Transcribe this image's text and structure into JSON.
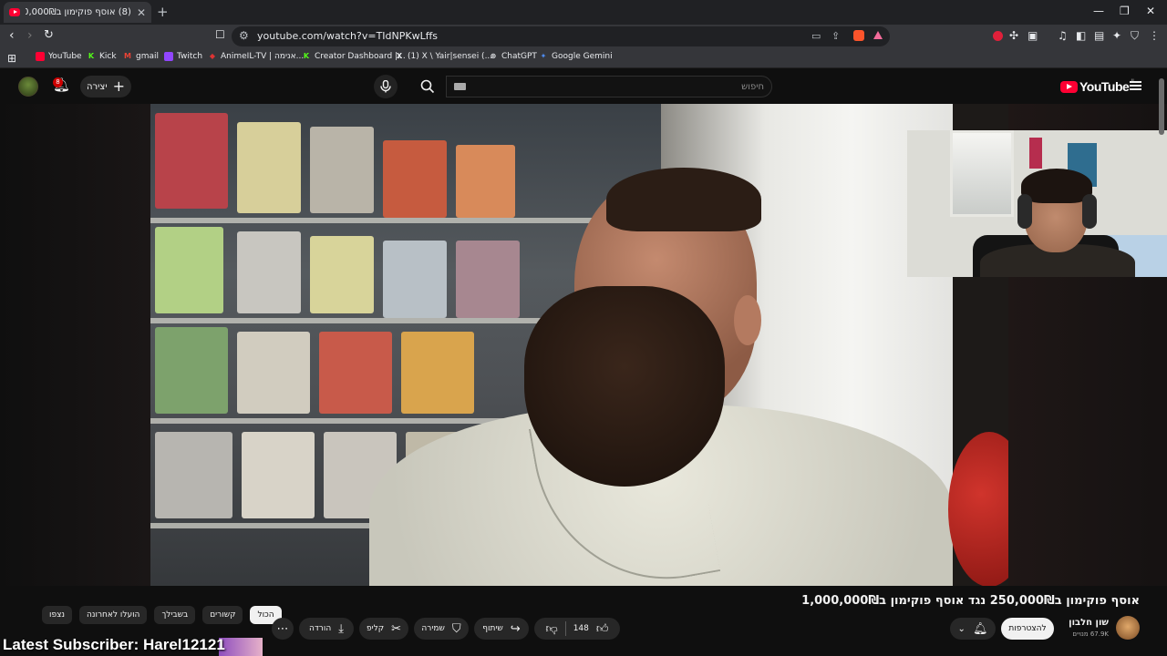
{
  "browser": {
    "tab_title": "(8) אוסף פוקימון ב250,000₪ נגד",
    "new_tab": "+",
    "url": "youtube.com/watch?v=TIdNPKwLffs",
    "window_controls": [
      "—",
      "❐",
      "✕"
    ],
    "bookmarks": [
      {
        "label": "YouTube",
        "icon": "youtube-icon",
        "color": "#ff0033"
      },
      {
        "label": "Kick",
        "icon": "kick-icon",
        "color": "#53fc18"
      },
      {
        "label": "gmail",
        "icon": "gmail-icon",
        "color": "#ea4335"
      },
      {
        "label": "Twitch",
        "icon": "twitch-icon",
        "color": "#9146ff"
      },
      {
        "label": "AnimeIL-TV | אנימה...",
        "icon": "animeil-icon",
        "color": "#d33"
      },
      {
        "label": "Creator Dashboard |...",
        "icon": "kick-icon",
        "color": "#53fc18"
      },
      {
        "label": "(1) X \\ Yair|sensei (...",
        "icon": "x-icon",
        "color": "#ffffff"
      },
      {
        "label": "ChatGPT",
        "icon": "chatgpt-icon",
        "color": "#ffffff"
      },
      {
        "label": "Google Gemini",
        "icon": "gemini-icon",
        "color": "#4e8cf5"
      }
    ]
  },
  "youtube": {
    "search_placeholder": "חיפוש",
    "create_label": "יצירה",
    "notification_count": "8",
    "logo_text": "YouTube",
    "logo_region": "IL"
  },
  "video": {
    "title": "אוסף פוקימון ב250,000₪ נגד אוסף פוקימון ב1,000,000₪",
    "channel_name": "שון חלבון",
    "channel_subs": "67.9K מנויים",
    "join_label": "להצטרפות",
    "likes": "148",
    "share_label": "שיתוף",
    "save_label": "שמירה",
    "clip_label": "קליפ",
    "download_label": "הורדה"
  },
  "chips": [
    "הכול",
    "קשורים",
    "בשבילך",
    "הועלו לאחרונה",
    "נצפו"
  ],
  "overlay": {
    "latest_subscriber": "Latest Subscriber: Harel12121"
  },
  "colors": {
    "accent": "#ff0033",
    "background": "#0f0f0f",
    "chip_bg": "#272727"
  }
}
